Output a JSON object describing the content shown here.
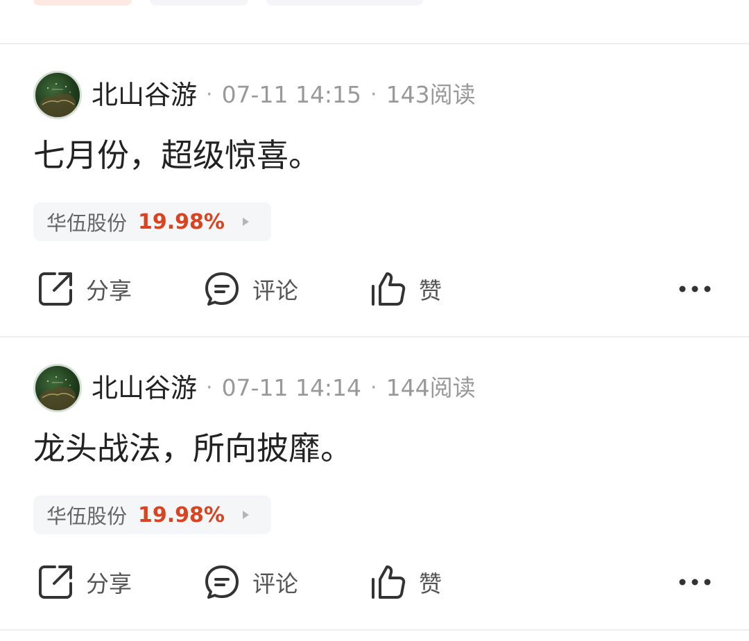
{
  "posts": [
    {
      "author": "北山谷游",
      "time": "07-11 14:15",
      "reads": "143阅读",
      "content": "七月份，超级惊喜。",
      "stock": {
        "name": "华伍股份",
        "change": "19.98%"
      },
      "actions": {
        "share": "分享",
        "comment": "评论",
        "like": "赞"
      }
    },
    {
      "author": "北山谷游",
      "time": "07-11 14:14",
      "reads": "144阅读",
      "content": "龙头战法，所向披靡。",
      "stock": {
        "name": "华伍股份",
        "change": "19.98%"
      },
      "actions": {
        "share": "分享",
        "comment": "评论",
        "like": "赞"
      }
    }
  ],
  "separator": "·",
  "icons": {
    "share": "share-icon",
    "comment": "comment-icon",
    "like": "thumbs-up-icon",
    "more": "more-icon",
    "stock_arrow": "play-arrow-icon"
  },
  "colors": {
    "stock_up": "#d9431f",
    "text_primary": "#222222",
    "text_meta": "#999999",
    "tag_bg": "#f5f6f8",
    "divider": "#eeeeee"
  }
}
